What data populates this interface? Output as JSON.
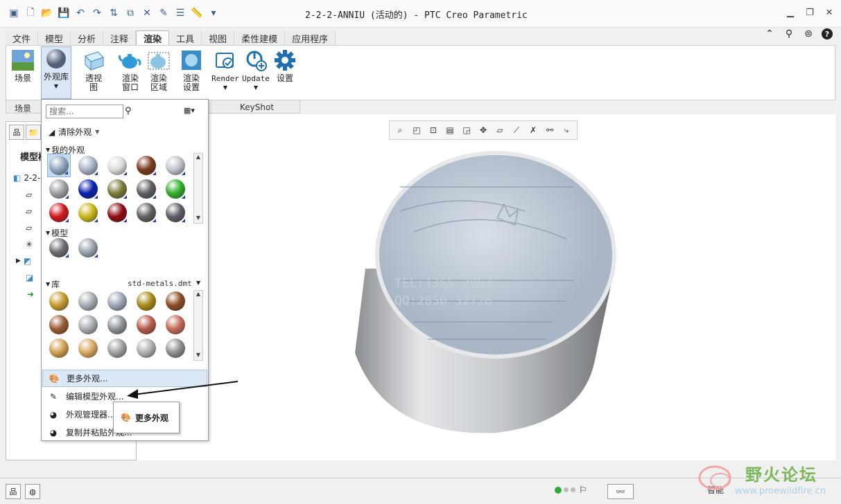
{
  "window": {
    "title": "2-2-2-ANNIU (活动的) - PTC Creo Parametric"
  },
  "tabs": [
    "文件",
    "模型",
    "分析",
    "注释",
    "渲染",
    "工具",
    "视图",
    "柔性建模",
    "应用程序"
  ],
  "active_tab": "渲染",
  "ribbon": {
    "scene": "场景",
    "appearance_lib": "外观库",
    "perspective_1": "透视",
    "perspective_2": "图",
    "render_window_1": "渲染",
    "render_window_2": "窗口",
    "render_region_1": "渲染",
    "render_region_2": "区域",
    "render_setup_1": "渲染",
    "render_setup_2": "设置",
    "render": "Render",
    "update": "Update",
    "settings": "设置"
  },
  "groups": {
    "scene": "场景",
    "keyshot": "KeyShot"
  },
  "model_tree": {
    "title": "模型树",
    "root": "2-2-2"
  },
  "dropdown": {
    "search_placeholder": "搜索...",
    "clear": "清除外观",
    "my_appearances": "我的外观",
    "model": "模型",
    "library": "库",
    "library_file": "std-metals.dmt",
    "more": "更多外观...",
    "edit": "编辑模型外观...",
    "manager": "外观管理器...",
    "copy_paste": "复制并粘贴外观..."
  },
  "tooltip": "更多外观",
  "status": {
    "smart": "智能"
  },
  "watermark": {
    "name": "野火论坛",
    "url": "www.proewildfire.cn"
  },
  "colors": {
    "my": [
      "#8fa5bd",
      "#a7b2c2",
      "#dcdcd8",
      "#7a3a1c",
      "#bfc4cc",
      "#9ea0a4",
      "#0a1fb0",
      "#7b7b3a",
      "#5c5f63",
      "#2fb02b",
      "#d0161c",
      "#c9b516",
      "#8c0c10",
      "#606060",
      "#5e5c66"
    ],
    "model": [
      "#6a6d74",
      "#9aa3b0"
    ],
    "lib": [
      "#c39a2c",
      "#a6acb4",
      "#9ca6b6",
      "#a88a18",
      "#8e4c24",
      "#9a5a30",
      "#a8adb3",
      "#8c9299",
      "#b55a4c",
      "#c56a58",
      "#d0a050",
      "#d9a860",
      "#9ea0a2",
      "#b0b0b0",
      "#8f8f8f"
    ]
  }
}
